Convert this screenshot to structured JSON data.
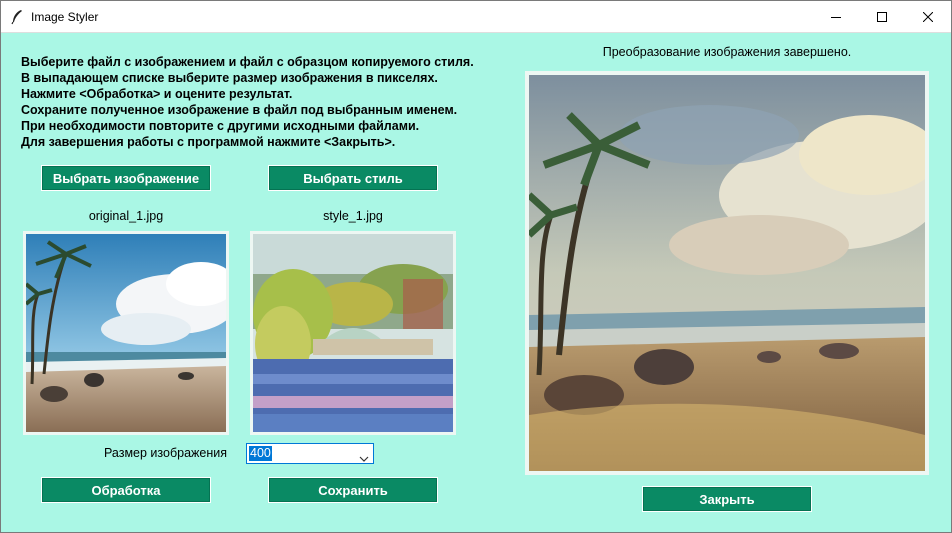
{
  "window": {
    "title": "Image Styler",
    "icon": "feather-icon",
    "controls": [
      "minimize-icon",
      "maximize-icon",
      "close-icon"
    ]
  },
  "instructions": [
    "Выберите файл с изображением и файл с образцом копируемого стиля.",
    "В выпадающем списке выберите размер изображения в пикселях.",
    "Нажмите <Обработка> и оцените результат.",
    "Сохраните полученное изображение в файл под выбранным именем.",
    "При необходимости повторите с другими исходными файлами.",
    "Для завершения работы с программой нажмите <Закрыть>."
  ],
  "buttons": {
    "choose_image": "Выбрать изображение",
    "choose_style": "Выбрать стиль",
    "process": "Обработка",
    "save": "Сохранить",
    "close": "Закрыть"
  },
  "files": {
    "original": "original_1.jpg",
    "style": "style_1.jpg"
  },
  "size": {
    "label": "Размер изображения",
    "selected": "400"
  },
  "status": "Преобразование изображения завершено.",
  "colors": {
    "background": "#aaf7e5",
    "button": "#0a8a64",
    "selection": "#0078d7"
  }
}
